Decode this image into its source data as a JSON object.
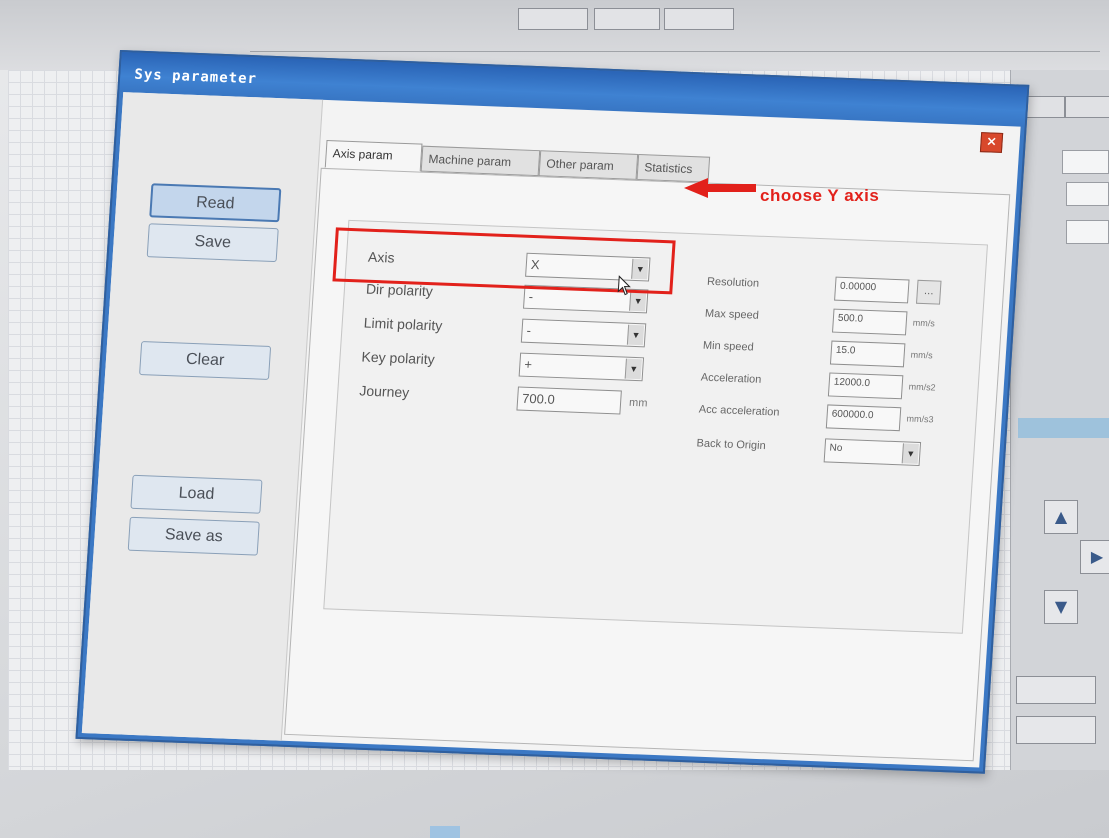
{
  "dialog": {
    "title": "Sys parameter",
    "close_glyph": "×"
  },
  "side_buttons": {
    "read": "Read",
    "save": "Save",
    "clear": "Clear",
    "load": "Load",
    "save_as": "Save as"
  },
  "tabs": [
    {
      "label": "Axis param",
      "active": true
    },
    {
      "label": "Machine param",
      "active": false
    },
    {
      "label": "Other param",
      "active": false
    },
    {
      "label": "Statistics",
      "active": false
    }
  ],
  "axis_form": {
    "axis_label": "Axis",
    "axis_value": "X",
    "dir_polarity_label": "Dir polarity",
    "dir_polarity_value": "-",
    "limit_polarity_label": "Limit polarity",
    "limit_polarity_value": "-",
    "key_polarity_label": "Key polarity",
    "key_polarity_value": "+",
    "journey_label": "Journey",
    "journey_value": "700.0",
    "journey_unit": "mm"
  },
  "right_form": {
    "resolution_label": "Resolution",
    "resolution_value": "0.00000",
    "resolution_btn": "...",
    "max_speed_label": "Max speed",
    "max_speed_value": "500.0",
    "max_speed_unit": "mm/s",
    "min_speed_label": "Min speed",
    "min_speed_value": "15.0",
    "min_speed_unit": "mm/s",
    "acceleration_label": "Acceleration",
    "acceleration_value": "12000.0",
    "acceleration_unit": "mm/s2",
    "acc_acceleration_label": "Acc acceleration",
    "acc_acceleration_value": "600000.0",
    "acc_acceleration_unit": "mm/s3",
    "back_to_origin_label": "Back to Origin",
    "back_to_origin_value": "No"
  },
  "annotation": {
    "text": "choose Y axis",
    "color": "#e2211b"
  },
  "colors": {
    "titlebar": "#3b78c4",
    "highlight": "#e2211b"
  }
}
